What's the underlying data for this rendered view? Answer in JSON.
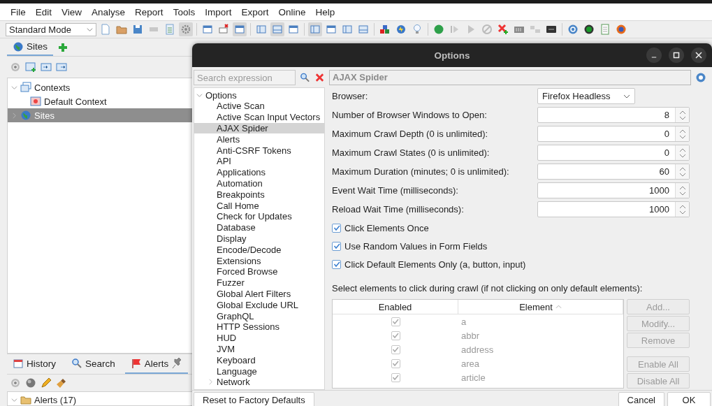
{
  "menu": [
    "File",
    "Edit",
    "View",
    "Analyse",
    "Report",
    "Tools",
    "Import",
    "Export",
    "Online",
    "Help"
  ],
  "toolbar": {
    "mode": "Standard Mode"
  },
  "sites_panel": {
    "tabs": [
      {
        "label": "Sites",
        "selected": true
      }
    ],
    "tree": [
      {
        "label": "Contexts",
        "expanded": true,
        "selected": false,
        "children": [
          {
            "label": "Default Context",
            "selected": false
          }
        ]
      },
      {
        "label": "Sites",
        "expanded": false,
        "selected": true
      }
    ]
  },
  "bottom_panel": {
    "tabs": [
      {
        "label": "History",
        "selected": false
      },
      {
        "label": "Search",
        "selected": false
      },
      {
        "label": "Alerts",
        "selected": true
      }
    ],
    "tree": [
      {
        "label": "Alerts (17)",
        "expanded": true
      }
    ]
  },
  "dialog": {
    "title": "Options",
    "search": {
      "placeholder": "Search expression"
    },
    "tree": [
      {
        "label": "Options",
        "expanded": true,
        "selected": false,
        "children": [
          {
            "label": "Active Scan",
            "selected": false
          },
          {
            "label": "Active Scan Input Vectors",
            "selected": false
          },
          {
            "label": "AJAX Spider",
            "selected": true
          },
          {
            "label": "Alerts",
            "selected": false
          },
          {
            "label": "Anti-CSRF Tokens",
            "selected": false
          },
          {
            "label": "API",
            "selected": false
          },
          {
            "label": "Applications",
            "selected": false
          },
          {
            "label": "Automation",
            "selected": false
          },
          {
            "label": "Breakpoints",
            "selected": false
          },
          {
            "label": "Call Home",
            "selected": false
          },
          {
            "label": "Check for Updates",
            "selected": false
          },
          {
            "label": "Database",
            "selected": false
          },
          {
            "label": "Display",
            "selected": false
          },
          {
            "label": "Encode/Decode",
            "selected": false
          },
          {
            "label": "Extensions",
            "selected": false
          },
          {
            "label": "Forced Browse",
            "selected": false
          },
          {
            "label": "Fuzzer",
            "selected": false
          },
          {
            "label": "Global Alert Filters",
            "selected": false
          },
          {
            "label": "Global Exclude URL",
            "selected": false
          },
          {
            "label": "GraphQL",
            "selected": false
          },
          {
            "label": "HTTP Sessions",
            "selected": false
          },
          {
            "label": "HUD",
            "selected": false
          },
          {
            "label": "JVM",
            "selected": false
          },
          {
            "label": "Keyboard",
            "selected": false
          },
          {
            "label": "Language",
            "selected": false
          },
          {
            "label": "Network",
            "expanded": false,
            "selected": false
          }
        ]
      }
    ],
    "panel_title": "AJAX Spider",
    "fields": [
      {
        "kind": "dropdown",
        "label": "Browser:",
        "value": "Firefox Headless"
      },
      {
        "kind": "spinner",
        "label": "Number of Browser Windows to Open:",
        "value": "8"
      },
      {
        "kind": "spinner",
        "label": "Maximum Crawl Depth (0 is unlimited):",
        "value": "0"
      },
      {
        "kind": "spinner",
        "label": "Maximum Crawl States (0 is unlimited):",
        "value": "0"
      },
      {
        "kind": "spinner",
        "label": "Maximum Duration (minutes; 0 is unlimited):",
        "value": "60"
      },
      {
        "kind": "spinner",
        "label": "Event Wait Time (milliseconds):",
        "value": "1000"
      },
      {
        "kind": "spinner",
        "label": "Reload Wait Time (milliseconds):",
        "value": "1000"
      }
    ],
    "checkboxes": [
      {
        "label": "Click Elements Once",
        "checked": true
      },
      {
        "label": "Use Random Values in Form Fields",
        "checked": true
      },
      {
        "label": "Click Default Elements Only (a, button, input)",
        "checked": true
      }
    ],
    "table_caption": "Select elements to click during crawl (if not clicking on only default elements):",
    "table": {
      "disabled": true,
      "columns": [
        "Enabled",
        "Element"
      ],
      "rows": [
        {
          "enabled": true,
          "element": "a"
        },
        {
          "enabled": true,
          "element": "abbr"
        },
        {
          "enabled": true,
          "element": "address"
        },
        {
          "enabled": true,
          "element": "area"
        },
        {
          "enabled": true,
          "element": "article"
        }
      ]
    },
    "side_buttons": [
      {
        "label": "Add...",
        "disabled": true
      },
      {
        "label": "Modify...",
        "disabled": true
      },
      {
        "label": "Remove",
        "disabled": true
      },
      {
        "label": "Enable All",
        "disabled": true
      },
      {
        "label": "Disable All",
        "disabled": true
      }
    ],
    "footer": {
      "reset": "Reset to Factory Defaults",
      "buttons": [
        "Cancel",
        "OK"
      ]
    }
  }
}
